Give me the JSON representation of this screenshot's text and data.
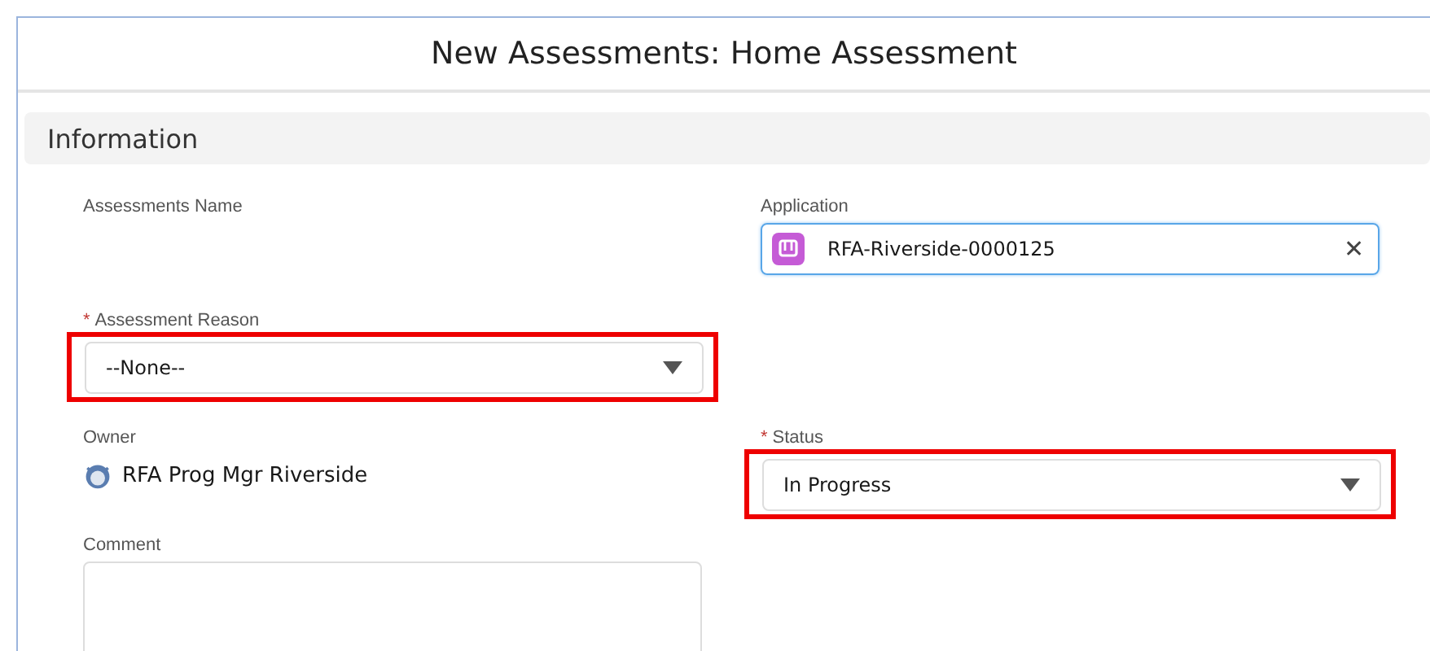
{
  "window": {
    "title": "New Assessments: Home Assessment"
  },
  "section": {
    "title": "Information"
  },
  "fields": [
    {
      "kind": "text",
      "label": "Assessments Name",
      "highlighted": false
    },
    {
      "kind": "lookup",
      "label": "Application",
      "highlighted": false,
      "value": "RFA-Riverside-0000125",
      "clear": "✕"
    },
    {
      "kind": "picklist",
      "required_mark": "*",
      "label": "Assessment Reason",
      "highlighted": true,
      "value": "--None--"
    },
    {
      "kind": "empty"
    },
    {
      "kind": "owner",
      "label": "Owner",
      "highlighted": false,
      "value": "RFA Prog Mgr Riverside"
    },
    {
      "kind": "picklist",
      "required_mark": "*",
      "label": "Status",
      "highlighted": true,
      "value": "In Progress"
    },
    {
      "kind": "textarea",
      "label": "Comment",
      "highlighted": false
    }
  ]
}
